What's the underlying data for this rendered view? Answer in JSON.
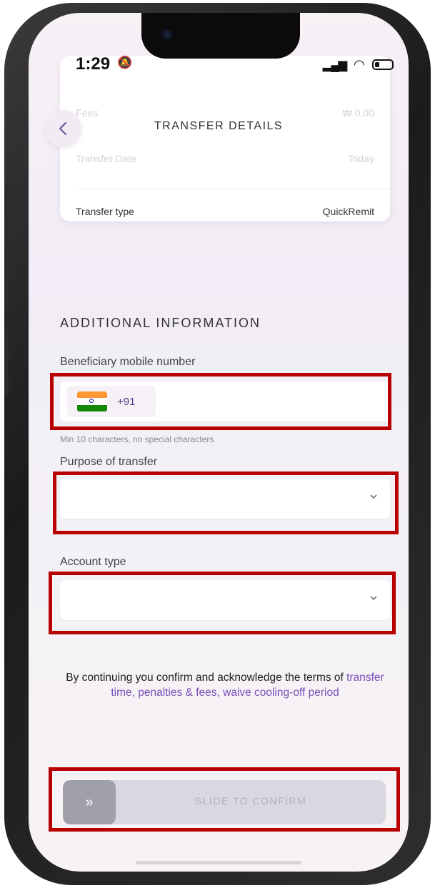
{
  "status_bar": {
    "time": "1:29",
    "bell_icon": "bell-slash-icon",
    "signal_icon": "signal-icon",
    "wifi_icon": "wifi-icon",
    "battery_icon": "battery-icon"
  },
  "header": {
    "title": "TRANSFER DETAILS",
    "back_icon": "chevron-left-icon"
  },
  "summary_card": {
    "faded_rows": [
      {
        "label": "Fees",
        "value": "₩ 0.00"
      },
      {
        "label": "Transfer Date",
        "value": "Today"
      }
    ],
    "transfer_type": {
      "label": "Transfer type",
      "value": "QuickRemit"
    }
  },
  "section_title": "ADDITIONAL INFORMATION",
  "form": {
    "mobile": {
      "label": "Beneficiary mobile number",
      "country_code": "+91",
      "value": "",
      "helper": "Min 10 characters, no special characters"
    },
    "purpose": {
      "label": "Purpose of transfer",
      "value": ""
    },
    "account_type": {
      "label": "Account type",
      "value": ""
    }
  },
  "terms": {
    "prefix": "By continuing you confirm and acknowledge the terms of",
    "link1": "transfer time, penalties & fees,",
    "link2": "waive cooling-off period"
  },
  "slider": {
    "handle": "»",
    "label": "SLIDE TO CONFIRM"
  },
  "colors": {
    "highlight": "#b80000",
    "accent": "#7a4fb8"
  }
}
